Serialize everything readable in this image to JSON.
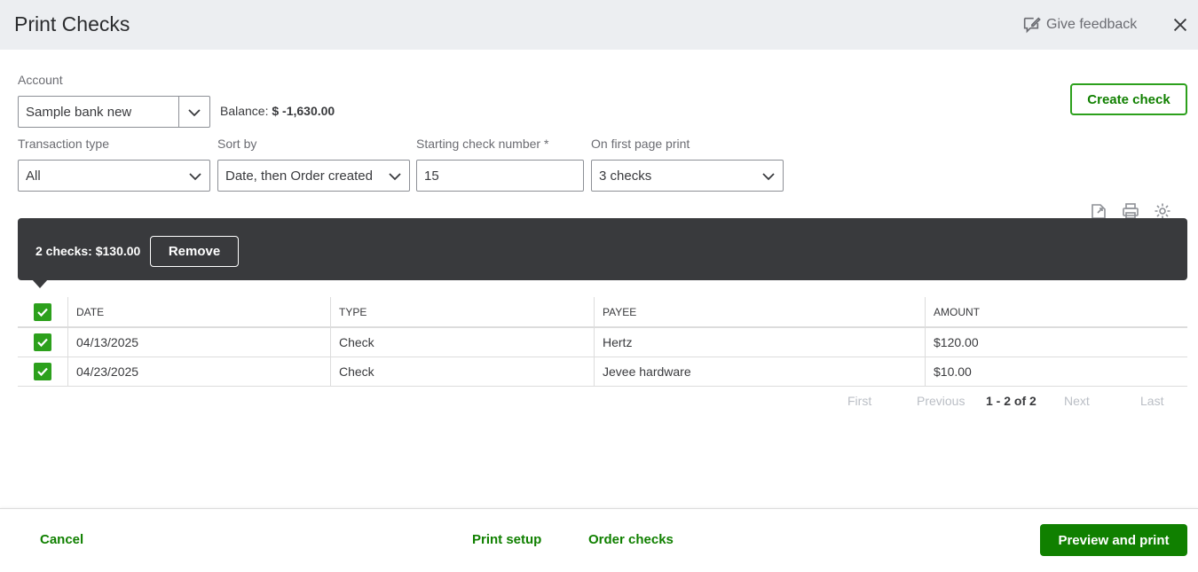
{
  "header": {
    "title": "Print Checks",
    "feedback_label": "Give feedback"
  },
  "account": {
    "label": "Account",
    "value": "Sample bank new",
    "balance_label": "Balance:",
    "balance_value": "$ -1,630.00"
  },
  "create_check_label": "Create check",
  "filters": {
    "transaction_type": {
      "label": "Transaction type",
      "value": "All"
    },
    "sort_by": {
      "label": "Sort by",
      "value": "Date, then Order created"
    },
    "starting_check_number": {
      "label": "Starting check number *",
      "value": "15"
    },
    "first_page_print": {
      "label": "On first page print",
      "value": "3 checks"
    }
  },
  "selection_banner": {
    "summary": "2 checks: $130.00",
    "remove_label": "Remove"
  },
  "table": {
    "columns": [
      "DATE",
      "TYPE",
      "PAYEE",
      "AMOUNT"
    ],
    "rows": [
      {
        "date": "04/13/2025",
        "type": "Check",
        "payee": "Hertz",
        "amount": "$120.00",
        "checked": true
      },
      {
        "date": "04/23/2025",
        "type": "Check",
        "payee": "Jevee hardware",
        "amount": "$10.00",
        "checked": true
      }
    ]
  },
  "pagination": {
    "first": "First",
    "previous": "Previous",
    "range": "1 - 2 of 2",
    "next": "Next",
    "last": "Last"
  },
  "footer": {
    "cancel": "Cancel",
    "print_setup": "Print setup",
    "order_checks": "Order checks",
    "preview_print": "Preview and print"
  },
  "colors": {
    "brand_green": "#108000",
    "check_green": "#2ca01c",
    "banner_dark": "#393a3d",
    "header_bg": "#eceef1"
  },
  "icons": [
    "feedback-icon",
    "close-icon",
    "chevron-down-icon",
    "export-icon",
    "printer-icon",
    "gear-icon",
    "checkmark-icon"
  ]
}
